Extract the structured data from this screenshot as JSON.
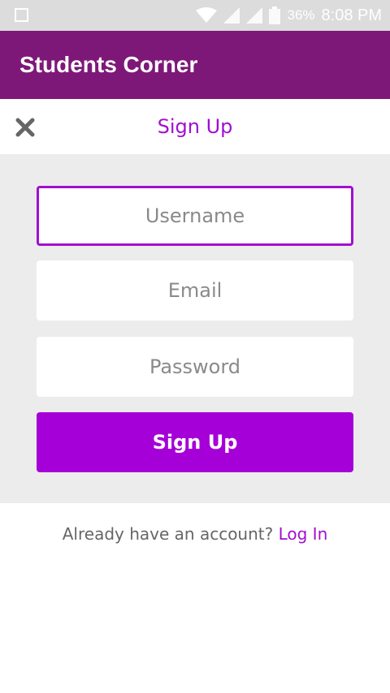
{
  "status_bar": {
    "battery_percent": "36%",
    "time": "8:08 PM"
  },
  "app": {
    "title": "Students Corner"
  },
  "header": {
    "title": "Sign Up",
    "close_icon": "close-icon"
  },
  "form": {
    "username_placeholder": "Username",
    "email_placeholder": "Email",
    "password_placeholder": "Password",
    "signup_label": "Sign Up"
  },
  "footer": {
    "prompt": "Already have an account?",
    "login_label": "Log In"
  },
  "colors": {
    "app_bar": "#7e1878",
    "accent": "#a10fd0",
    "button": "#a500d8"
  }
}
